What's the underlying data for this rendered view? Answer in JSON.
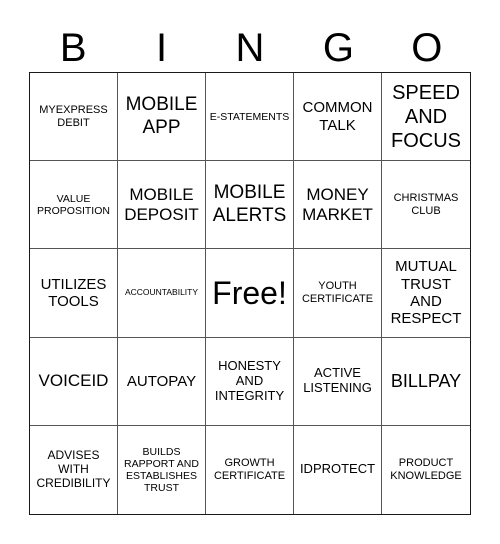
{
  "header": {
    "letters": [
      "B",
      "I",
      "N",
      "G",
      "O"
    ]
  },
  "board": {
    "rows": [
      [
        "MYEXPRESS DEBIT",
        "MOBILE APP",
        "E-STATEMENTS",
        "COMMON TALK",
        "SPEED AND FOCUS"
      ],
      [
        "VALUE PROPOSITION",
        "MOBILE DEPOSIT",
        "MOBILE ALERTS",
        "MONEY MARKET",
        "CHRISTMAS CLUB"
      ],
      [
        "UTILIZES TOOLS",
        "ACCOUNTABILITY",
        "Free!",
        "YOUTH CERTIFICATE",
        "MUTUAL TRUST AND RESPECT"
      ],
      [
        "VOICEID",
        "AUTOPAY",
        "HONESTY AND INTEGRITY",
        "ACTIVE LISTENING",
        "BILLPAY"
      ],
      [
        "ADVISES WITH CREDIBILITY",
        "BUILDS RAPPORT AND ESTABLISHES TRUST",
        "GROWTH CERTIFICATE",
        "IDPROTECT",
        "PRODUCT KNOWLEDGE"
      ]
    ]
  }
}
